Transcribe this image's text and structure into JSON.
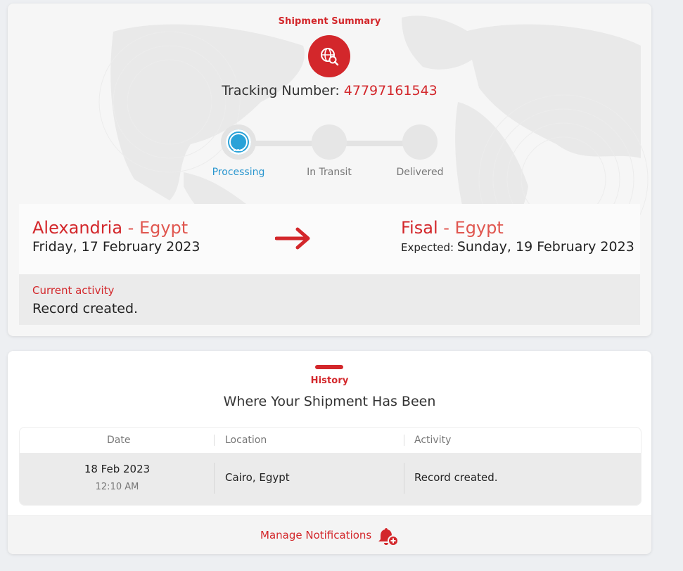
{
  "summary": {
    "title": "Shipment Summary",
    "badge_icon": "globe-search-icon",
    "tracking_label": "Tracking Number: ",
    "tracking_number": "47797161543",
    "steps": [
      {
        "label": "Processing",
        "state": "active"
      },
      {
        "label": "In Transit",
        "state": "pending"
      },
      {
        "label": "Delivered",
        "state": "pending"
      }
    ],
    "origin": {
      "city": "Alexandria",
      "separator": " - ",
      "country": "Egypt",
      "date": "Friday, 17 February 2023"
    },
    "destination": {
      "city": "Fisal",
      "separator": " - ",
      "country": "Egypt",
      "expected_label": "Expected: ",
      "date": "Sunday, 19 February 2023"
    },
    "current_activity": {
      "label": "Current activity",
      "value": "Record created."
    }
  },
  "history": {
    "title": "History",
    "subtitle": "Where Your Shipment Has Been",
    "columns": [
      "Date",
      "Location",
      "Activity"
    ],
    "rows": [
      {
        "date": "18 Feb 2023",
        "time": "12:10 AM",
        "location": "Cairo, Egypt",
        "activity": "Record created."
      }
    ]
  },
  "footer": {
    "manage_label": "Manage Notifications",
    "icon": "bell-add-icon"
  },
  "colors": {
    "accent": "#d3272b",
    "processing": "#2aa2d8",
    "background": "#edeff2"
  }
}
